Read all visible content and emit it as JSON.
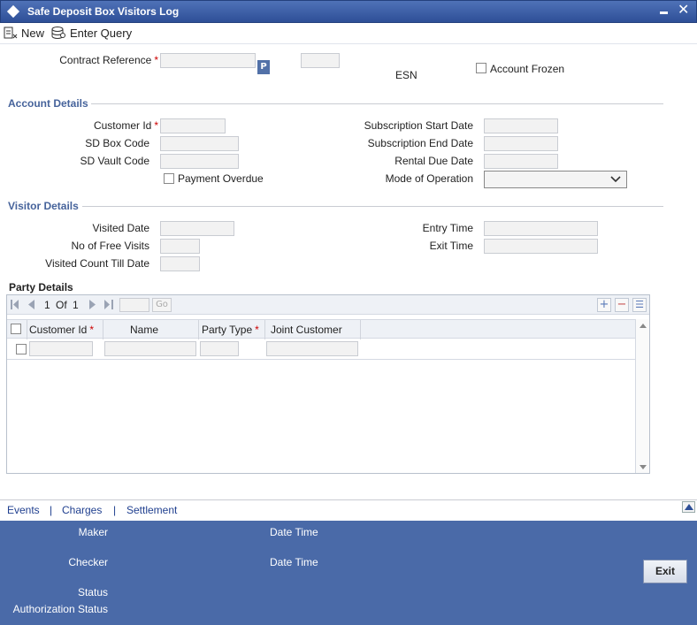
{
  "window": {
    "title": "Safe Deposit Box Visitors Log"
  },
  "toolbar": {
    "new_label": "New",
    "enter_query_label": "Enter Query"
  },
  "header": {
    "contract_reference_label": "Contract Reference",
    "p_button": "P",
    "esn_label": "ESN",
    "account_frozen_label": "Account Frozen"
  },
  "account_details": {
    "title": "Account Details",
    "customer_id_label": "Customer Id",
    "sd_box_code_label": "SD Box Code",
    "sd_vault_code_label": "SD Vault Code",
    "payment_overdue_label": "Payment Overdue",
    "subscription_start_label": "Subscription Start Date",
    "subscription_end_label": "Subscription End Date",
    "rental_due_label": "Rental Due Date",
    "mode_of_operation_label": "Mode of Operation"
  },
  "visitor_details": {
    "title": "Visitor Details",
    "visited_date_label": "Visited Date",
    "free_visits_label": "No of Free Visits",
    "visited_count_label": "Visited Count Till Date",
    "entry_time_label": "Entry Time",
    "exit_time_label": "Exit Time"
  },
  "party_details": {
    "title": "Party Details",
    "pager": {
      "current": "1",
      "of": "Of",
      "total": "1",
      "go": "Go"
    },
    "columns": [
      "Customer Id",
      "Name",
      "Party Type",
      "Joint Customer"
    ],
    "required_mark": "*"
  },
  "links": {
    "events": "Events",
    "charges": "Charges",
    "settlement": "Settlement",
    "separator": "|"
  },
  "footer": {
    "maker_label": "Maker",
    "checker_label": "Checker",
    "date_time_label": "Date Time",
    "status_label": "Status",
    "auth_status_label": "Authorization Status",
    "exit_label": "Exit"
  }
}
